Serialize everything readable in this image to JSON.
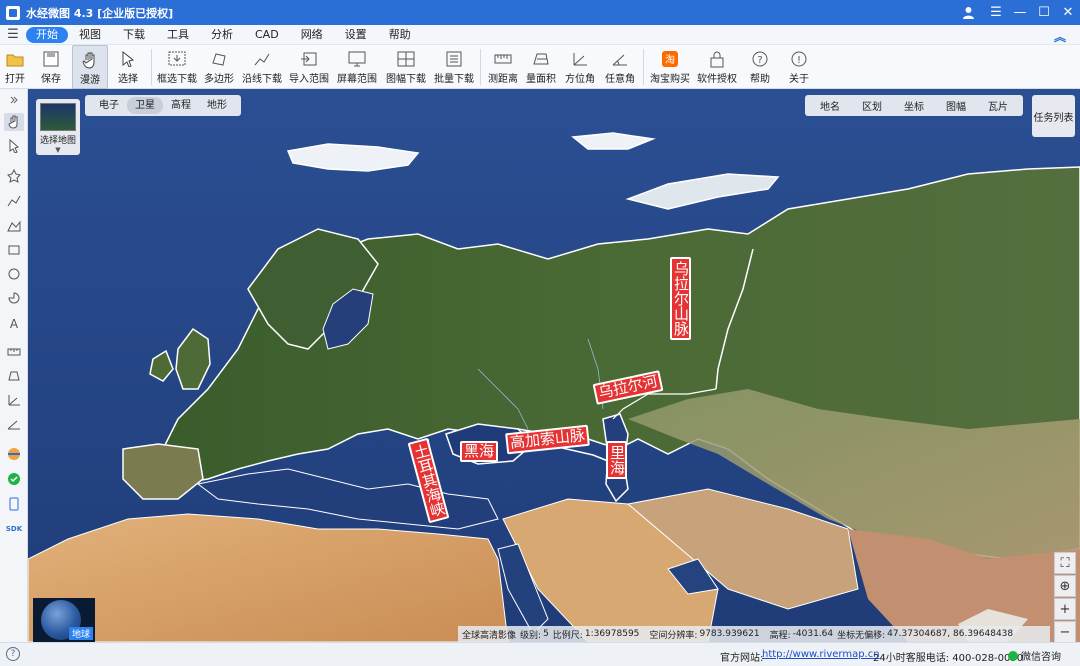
{
  "window": {
    "title": "水经微图 4.3 [企业版已授权]"
  },
  "menu": {
    "items": [
      "开始",
      "视图",
      "下载",
      "工具",
      "分析",
      "CAD",
      "网络",
      "设置",
      "帮助"
    ],
    "active": "开始"
  },
  "toolbar": {
    "items": [
      {
        "label": "打开",
        "icon": "folder-icon"
      },
      {
        "label": "保存",
        "icon": "save-icon"
      },
      {
        "label": "漫游",
        "icon": "hand-icon"
      },
      {
        "label": "选择",
        "icon": "cursor-icon"
      },
      {
        "label": "框选下载",
        "icon": "box-download-icon"
      },
      {
        "label": "多边形",
        "icon": "polygon-icon"
      },
      {
        "label": "沿线下载",
        "icon": "line-download-icon"
      },
      {
        "label": "导入范围",
        "icon": "import-range-icon"
      },
      {
        "label": "屏幕范围",
        "icon": "screen-range-icon"
      },
      {
        "label": "图幅下载",
        "icon": "sheet-download-icon"
      },
      {
        "label": "批量下载",
        "icon": "batch-download-icon"
      },
      {
        "label": "测距离",
        "icon": "ruler-icon"
      },
      {
        "label": "量面积",
        "icon": "area-icon"
      },
      {
        "label": "方位角",
        "icon": "azimuth-icon"
      },
      {
        "label": "任意角",
        "icon": "angle-icon"
      },
      {
        "label": "淘宝购买",
        "icon": "taobao-icon"
      },
      {
        "label": "软件授权",
        "icon": "lock-icon"
      },
      {
        "label": "帮助",
        "icon": "help-icon"
      },
      {
        "label": "关于",
        "icon": "info-icon"
      }
    ]
  },
  "map_types": [
    "电子",
    "卫星",
    "高程",
    "地形"
  ],
  "map_type_active": "卫星",
  "layers": [
    "地名",
    "区划",
    "坐标",
    "图幅",
    "瓦片"
  ],
  "task_list": "任务列表",
  "select_map": "选择地图",
  "globe_label": "地球",
  "status": {
    "imagery": "全球高清影像",
    "level_label": "级别:",
    "level": "5",
    "scale_label": "比例尺:",
    "scale": "1:36978595",
    "resolution_label": "空间分辨率:",
    "resolution": "9783.939621",
    "elevation_label": "高程:",
    "elevation": "-4031.64",
    "offset_label": "坐标无偏移:",
    "coords": "47.37304687, 86.39648438"
  },
  "map_labels": {
    "ural_mountains": "乌拉尔山脉",
    "ural_river": "乌拉尔河",
    "caucasus": "高加索山脉",
    "black_sea": "黑海",
    "caspian_sea": "里海",
    "turkish_straits": "土耳其海峡"
  },
  "footer": {
    "site_label": "官方网站:",
    "site_url": "http://www.rivermap.cn",
    "phone": "24小时客服电话: 400-028-0050",
    "wechat": "微信咨询"
  },
  "colors": {
    "titlebar": "#2b6fd6",
    "accent": "#2b82f0",
    "label_bg": "#e53333"
  }
}
